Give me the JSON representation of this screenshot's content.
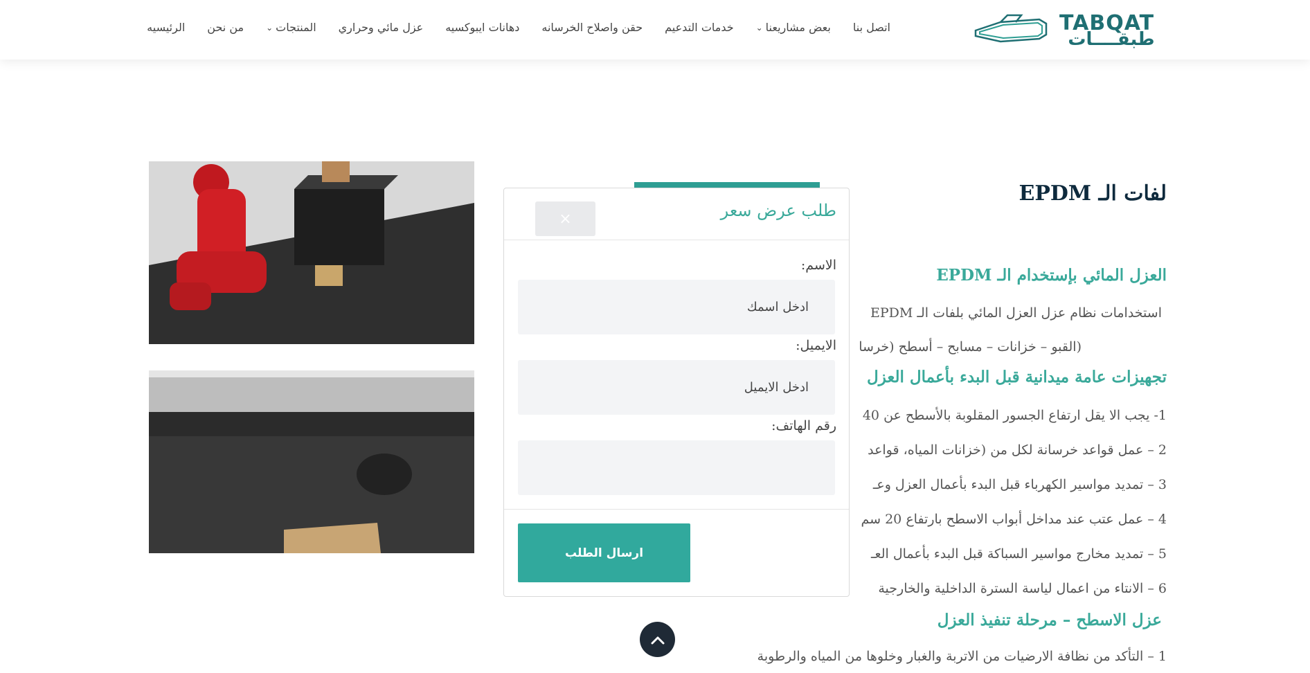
{
  "logo": {
    "latin": "TABQAT",
    "arabic": "طبقــــات"
  },
  "nav": [
    {
      "label": "الرئيسيه",
      "has_dropdown": false
    },
    {
      "label": "من نحن",
      "has_dropdown": false
    },
    {
      "label": "المنتجات",
      "has_dropdown": true
    },
    {
      "label": "عزل مائي وحراري",
      "has_dropdown": false
    },
    {
      "label": "دهانات ايبوكسيه",
      "has_dropdown": false
    },
    {
      "label": "حقن واصلاح الخرسانه",
      "has_dropdown": false
    },
    {
      "label": "خدمات التدعيم",
      "has_dropdown": false
    },
    {
      "label": "بعض مشاريعنا",
      "has_dropdown": true
    },
    {
      "label": "اتصل بنا",
      "has_dropdown": false
    }
  ],
  "page": {
    "title": "لفات الـ EPDM",
    "section1_heading": "العزل المائي بإستخدام الـ EPDM",
    "section1_p1": "استخدامات نظام عزل العزل المائي بلفات الـ EPDM",
    "section1_p2": "(القبو – خزانات – مسابح – أسطح (خرسا",
    "section2_heading": "تجهيزات عامة ميدانية قبل البدء بأعمال العزل",
    "items": [
      "1- يجب الا يقل ارتفاع الجسور المقلوبة بالأسطح عن 40",
      "2 – عمل قواعد خرسانة لكل من (خزانات المياه، قواعد",
      "3 – تمديد مواسير الكهرباء قبل البدء بأعمال العزل وعـ",
      "4 – عمل عتب عند مداخل أبواب الاسطح بارتفاع 20 سم",
      "5 – تمديد مخارج مواسير السباكة قبل البدء بأعمال العـ",
      "6 – الانتاء من اعمال لياسة السترة الداخلية والخارجية"
    ],
    "section3_heading": "عزل الاسطح – مرحلة تنفيذ العزل",
    "section3_p1": "1 – التأكد من نظافة الارضيات من الاتربة والغبار وخلوها من المياه والرطوبة"
  },
  "modal": {
    "title": "طلب عرض سعر",
    "close_icon": "×",
    "name_label": "الاسم:",
    "name_placeholder": "ادخل اسمك",
    "email_label": "الايميل:",
    "email_placeholder": "ادخل الايميل",
    "phone_label": "رقم الهاتف:",
    "phone_placeholder": "",
    "submit_label": "ارسال الطلب"
  },
  "colors": {
    "accent": "#31a99d",
    "heading": "#3aa99a",
    "title": "#0e2a3d",
    "dark_button": "#1f2a36"
  }
}
